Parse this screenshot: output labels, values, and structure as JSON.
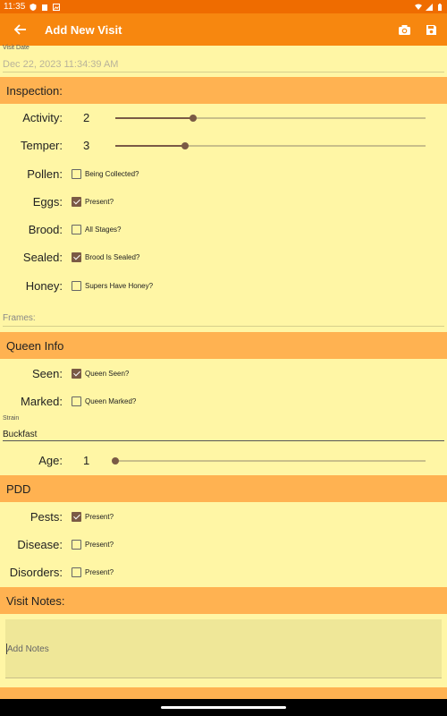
{
  "status_bar": {
    "time": "11:35"
  },
  "app_bar": {
    "title": "Add New Visit"
  },
  "visit_date": {
    "label": "Visit Date",
    "value": "Dec 22, 2023 11:34:39 AM"
  },
  "inspection": {
    "header": "Inspection:",
    "activity": {
      "label": "Activity:",
      "value": "2",
      "level": 0.25
    },
    "temper": {
      "label": "Temper:",
      "value": "3",
      "level": 0.225
    },
    "pollen": {
      "label": "Pollen:",
      "checkbox_label": "Being Collected?",
      "checked": false
    },
    "eggs": {
      "label": "Eggs:",
      "checkbox_label": "Present?",
      "checked": true
    },
    "brood": {
      "label": "Brood:",
      "checkbox_label": "All Stages?",
      "checked": false
    },
    "sealed": {
      "label": "Sealed:",
      "checkbox_label": "Brood Is Sealed?",
      "checked": true
    },
    "honey": {
      "label": "Honey:",
      "checkbox_label": "Supers Have Honey?",
      "checked": false
    },
    "frames_placeholder": "Frames:"
  },
  "queen_info": {
    "header": "Queen Info",
    "seen": {
      "label": "Seen:",
      "checkbox_label": "Queen Seen?",
      "checked": true
    },
    "marked": {
      "label": "Marked:",
      "checkbox_label": "Queen Marked?",
      "checked": false
    },
    "strain": {
      "label": "Strain",
      "value": "Buckfast"
    },
    "age": {
      "label": "Age:",
      "value": "1",
      "level": 0.0
    }
  },
  "pdd": {
    "header": "PDD",
    "pests": {
      "label": "Pests:",
      "checkbox_label": "Present?",
      "checked": true
    },
    "disease": {
      "label": "Disease:",
      "checkbox_label": "Present?",
      "checked": false
    },
    "disorders": {
      "label": "Disorders:",
      "checkbox_label": "Present?",
      "checked": false
    }
  },
  "visit_notes": {
    "header": "Visit Notes:",
    "placeholder": "Add Notes"
  },
  "colors": {
    "status_bar": "#ef6c00",
    "app_bar": "#f7870f",
    "background": "#fff6a5",
    "section_header": "#ffb251",
    "accent": "#7a5a45"
  },
  "icons": {
    "back": "arrow-back-icon",
    "camera": "camera-icon",
    "save": "save-icon"
  }
}
